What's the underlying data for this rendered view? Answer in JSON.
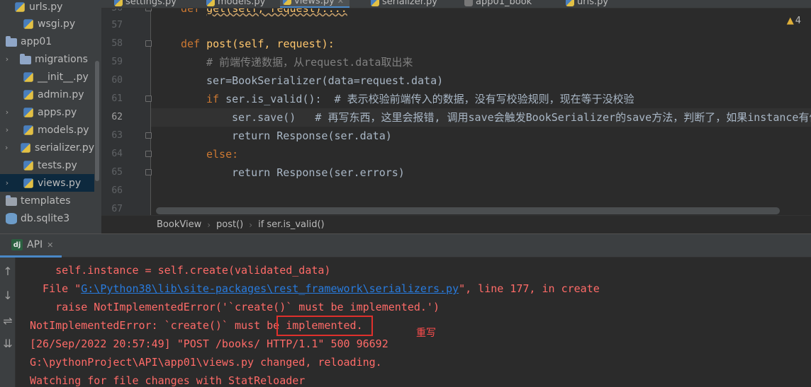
{
  "tabs": [
    {
      "label": "settings.py"
    },
    {
      "label": "models.py"
    },
    {
      "label": "views.py",
      "active": true
    },
    {
      "label": "serializer.py"
    },
    {
      "label": "app01_book"
    },
    {
      "label": "urls.py"
    }
  ],
  "tree": {
    "items": [
      {
        "label": "urls.py",
        "icon": "python-file-icon",
        "indent": 2
      },
      {
        "label": "wsgi.py",
        "icon": "python-file-icon",
        "indent": 2
      },
      {
        "label": "app01",
        "icon": "folder-icon",
        "indent": 0
      },
      {
        "label": "migrations",
        "icon": "folder-icon",
        "indent": 1,
        "arrow": true
      },
      {
        "label": "__init__.py",
        "icon": "python-file-icon",
        "indent": 2
      },
      {
        "label": "admin.py",
        "icon": "python-file-icon",
        "indent": 2
      },
      {
        "label": "apps.py",
        "icon": "python-file-icon",
        "indent": 1,
        "arrow": true
      },
      {
        "label": "models.py",
        "icon": "python-file-icon",
        "indent": 1,
        "arrow": true
      },
      {
        "label": "serializer.py",
        "icon": "python-file-icon",
        "indent": 1,
        "arrow": true
      },
      {
        "label": "tests.py",
        "icon": "python-file-icon",
        "indent": 2
      },
      {
        "label": "views.py",
        "icon": "python-file-icon",
        "indent": 1,
        "arrow": true,
        "selected": true
      },
      {
        "label": "templates",
        "icon": "folder-icon",
        "indent": 0
      },
      {
        "label": "db.sqlite3",
        "icon": "database-icon",
        "indent": 0
      }
    ]
  },
  "editor": {
    "warning_count": "4",
    "lines": [
      {
        "num": "56",
        "code": "def get(self, request):..."
      },
      {
        "num": "57",
        "code": ""
      },
      {
        "num": "58",
        "code": "def post(self, request):"
      },
      {
        "num": "59",
        "code": "# 前端传递数据，从request.data取出来"
      },
      {
        "num": "60",
        "code": "ser=BookSerializer(data=request.data)"
      },
      {
        "num": "61",
        "code": "if ser.is_valid():  # 表示校验前端传入的数据，没有写校验规则，现在等于没校验"
      },
      {
        "num": "62",
        "code": "ser.save()   # 再写东西，这里会报错, 调用save会触发BookSerializer的save方法，判断了，如果instance有值执行update，没有值执行create"
      },
      {
        "num": "63",
        "code": "return Response(ser.data)"
      },
      {
        "num": "64",
        "code": "else:"
      },
      {
        "num": "65",
        "code": "return Response(ser.errors)"
      },
      {
        "num": "66",
        "code": ""
      },
      {
        "num": "67",
        "code": ""
      }
    ]
  },
  "breadcrumb": [
    "BookView",
    "post()",
    "if ser.is_valid()"
  ],
  "run": {
    "tab_label": "API",
    "console_lines": [
      "    self.instance = self.create(validated_data)",
      "  File \"",
      "    raise NotImplementedError('`create()` must be implemented.')",
      "NotImplementedError: `create()` must be implemented.",
      "[26/Sep/2022 20:57:49] \"POST /books/ HTTP/1.1\" 500 96692",
      "G:\\pythonProject\\API\\app01\\views.py changed, reloading.",
      "Watching for file changes with StatReloader"
    ],
    "file_link": "G:\\Python38\\lib\\site-packages\\rest_framework\\serializers.py",
    "file_suffix": "\", line 177, in create",
    "annotation": "重写"
  },
  "colors": {
    "error_text": "#ff6b68",
    "link": "#287bde",
    "highlight_box": "#e0302c",
    "accent_tab": "#4a88c7"
  }
}
